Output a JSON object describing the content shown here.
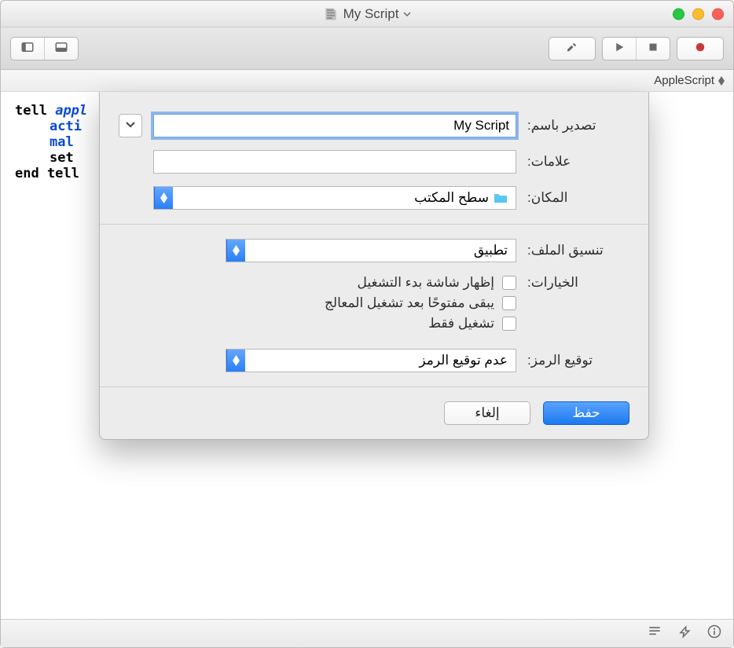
{
  "window": {
    "title": "My Script"
  },
  "langbar": {
    "label": "AppleScript"
  },
  "editor": {
    "line1_kw": "tell",
    "line1_app": "appl",
    "line2": "acti",
    "line3": "mal",
    "line4_kw": "set",
    "line5_kw": "end tell"
  },
  "sheet": {
    "export_as_label": "تصدير باسم:",
    "export_as_value": "My Script",
    "tags_label": "علامات:",
    "tags_value": "",
    "where_label": "المكان:",
    "where_value": "سطح المكتب",
    "file_format_label": "تنسيق الملف:",
    "file_format_value": "تطبيق",
    "options_label": "الخيارات:",
    "options": [
      "إظهار شاشة بدء التشغيل",
      "يبقى مفتوحًا بعد تشغيل المعالج",
      "تشغيل فقط"
    ],
    "code_sign_label": "توقيع الرمز:",
    "code_sign_value": "عدم توقيع الرمز",
    "save_btn": "حفظ",
    "cancel_btn": "إلغاء"
  }
}
